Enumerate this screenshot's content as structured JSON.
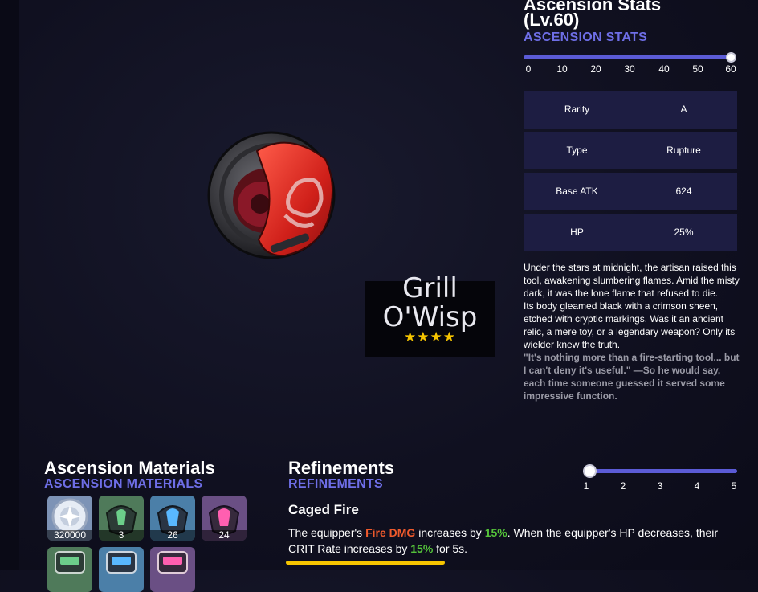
{
  "weapon": {
    "name_line1": "Grill",
    "name_line2": "O'Wisp",
    "stars": "★★★★"
  },
  "ascension_stats": {
    "title_line1": "Ascension Stats",
    "title_line2": "(Lv.60)",
    "subtitle": "ASCENSION STATS",
    "slider": {
      "min": 0,
      "max": 60,
      "value": 60,
      "ticks": [
        "0",
        "10",
        "20",
        "30",
        "40",
        "50",
        "60"
      ]
    },
    "rows": [
      {
        "label": "Rarity",
        "value": "A"
      },
      {
        "label": "Type",
        "value": "Rupture"
      },
      {
        "label": "Base ATK",
        "value": "624"
      },
      {
        "label": "HP",
        "value": "25%"
      }
    ]
  },
  "description": {
    "p1": "Under the stars at midnight, the artisan raised this tool, awakening slumbering flames. Amid the misty dark, it was the lone flame that refused to die.",
    "p2": "Its body gleamed black with a crimson sheen, etched with cryptic markings. Was it an ancient relic, a mere toy, or a legendary weapon? Only its wielder knew the truth.",
    "quote": "\"It's nothing more than a fire-starting tool... but I can't deny it's useful.\" —So he would say, each time someone guessed it served some impressive function."
  },
  "materials": {
    "title": "Ascension Materials",
    "subtitle": "ASCENSION MATERIALS",
    "items": [
      {
        "icon": "silver-coin-icon",
        "count": "320000",
        "bg": "#7d93b6"
      },
      {
        "icon": "green-chip-icon",
        "count": "3",
        "bg": "#4f7a5a"
      },
      {
        "icon": "blue-chip-icon",
        "count": "26",
        "bg": "#4b7fa8"
      },
      {
        "icon": "pink-chip-icon",
        "count": "24",
        "bg": "#6a4f84"
      },
      {
        "icon": "green-battery-icon",
        "bg": "#4f7a5a"
      },
      {
        "icon": "blue-battery-icon",
        "bg": "#4b7fa8"
      },
      {
        "icon": "pink-battery-icon",
        "bg": "#6a4f84"
      }
    ]
  },
  "refinements": {
    "title": "Refinements",
    "subtitle": "REFINEMENTS",
    "slider": {
      "min": 1,
      "max": 5,
      "value": 1,
      "ticks": [
        "1",
        "2",
        "3",
        "4",
        "5"
      ]
    },
    "skill_name": "Caged Fire",
    "text_1": "The equipper's ",
    "hl_1": "Fire DMG",
    "text_2": " increases by ",
    "hl_2": "15%",
    "text_3": ". When the equipper's HP decreases, their CRIT Rate increases by ",
    "hl_3": "15%",
    "text_4": " for 5s."
  },
  "colors": {
    "accent": "#5b5bd6",
    "subtitle": "#6e6ee6",
    "star": "#f5c400",
    "fire": "#ef5a2c",
    "buff": "#54c23a",
    "stat_row_bg": "#1d1d42"
  }
}
